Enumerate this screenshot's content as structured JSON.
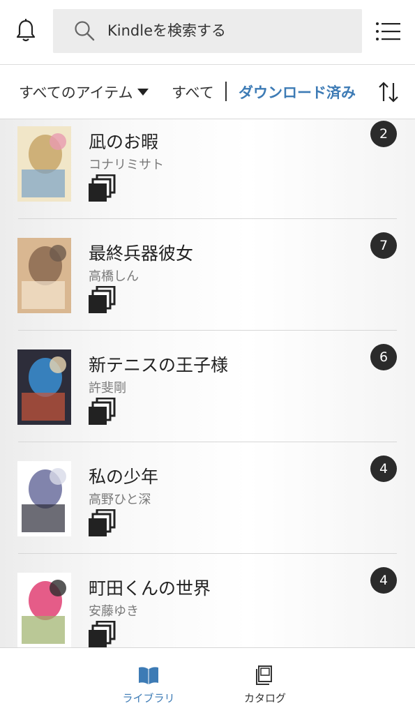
{
  "header": {
    "bell_icon": "bell-icon",
    "search_placeholder": "Kindleを検索する",
    "menu_icon": "list-menu-icon"
  },
  "filters": {
    "all_items": "すべてのアイテム",
    "all": "すべて",
    "downloaded": "ダウンロード済み",
    "sort_icon": "sort-arrows-icon",
    "accent_color": "#3d7bb5"
  },
  "books": [
    {
      "title": "凪のお暇",
      "author": "コナリミサト",
      "count": "2",
      "cover_palette": [
        "#f1e6c8",
        "#c8a66a",
        "#7aa3c6",
        "#e89bb0"
      ]
    },
    {
      "title": "最終兵器彼女",
      "author": "高橋しん",
      "count": "7",
      "cover_palette": [
        "#d9b791",
        "#8a6a50",
        "#f3e4cf",
        "#6d5a4c"
      ]
    },
    {
      "title": "新テニスの王子様",
      "author": "許斐剛",
      "count": "6",
      "cover_palette": [
        "#2d2d3a",
        "#3a8fd3",
        "#c9553b",
        "#e8d4b0"
      ]
    },
    {
      "title": "私の少年",
      "author": "高野ひと深",
      "count": "4",
      "cover_palette": [
        "#ffffff",
        "#6b6f9e",
        "#2d2d3a",
        "#d8dbe8"
      ]
    },
    {
      "title": "町田くんの世界",
      "author": "安藤ゆき",
      "count": "4",
      "cover_palette": [
        "#ffffff",
        "#e13f73",
        "#9cb06a",
        "#2d2d2d"
      ]
    }
  ],
  "bottom_nav": {
    "library": "ライブラリ",
    "catalog": "カタログ",
    "active": "library"
  }
}
